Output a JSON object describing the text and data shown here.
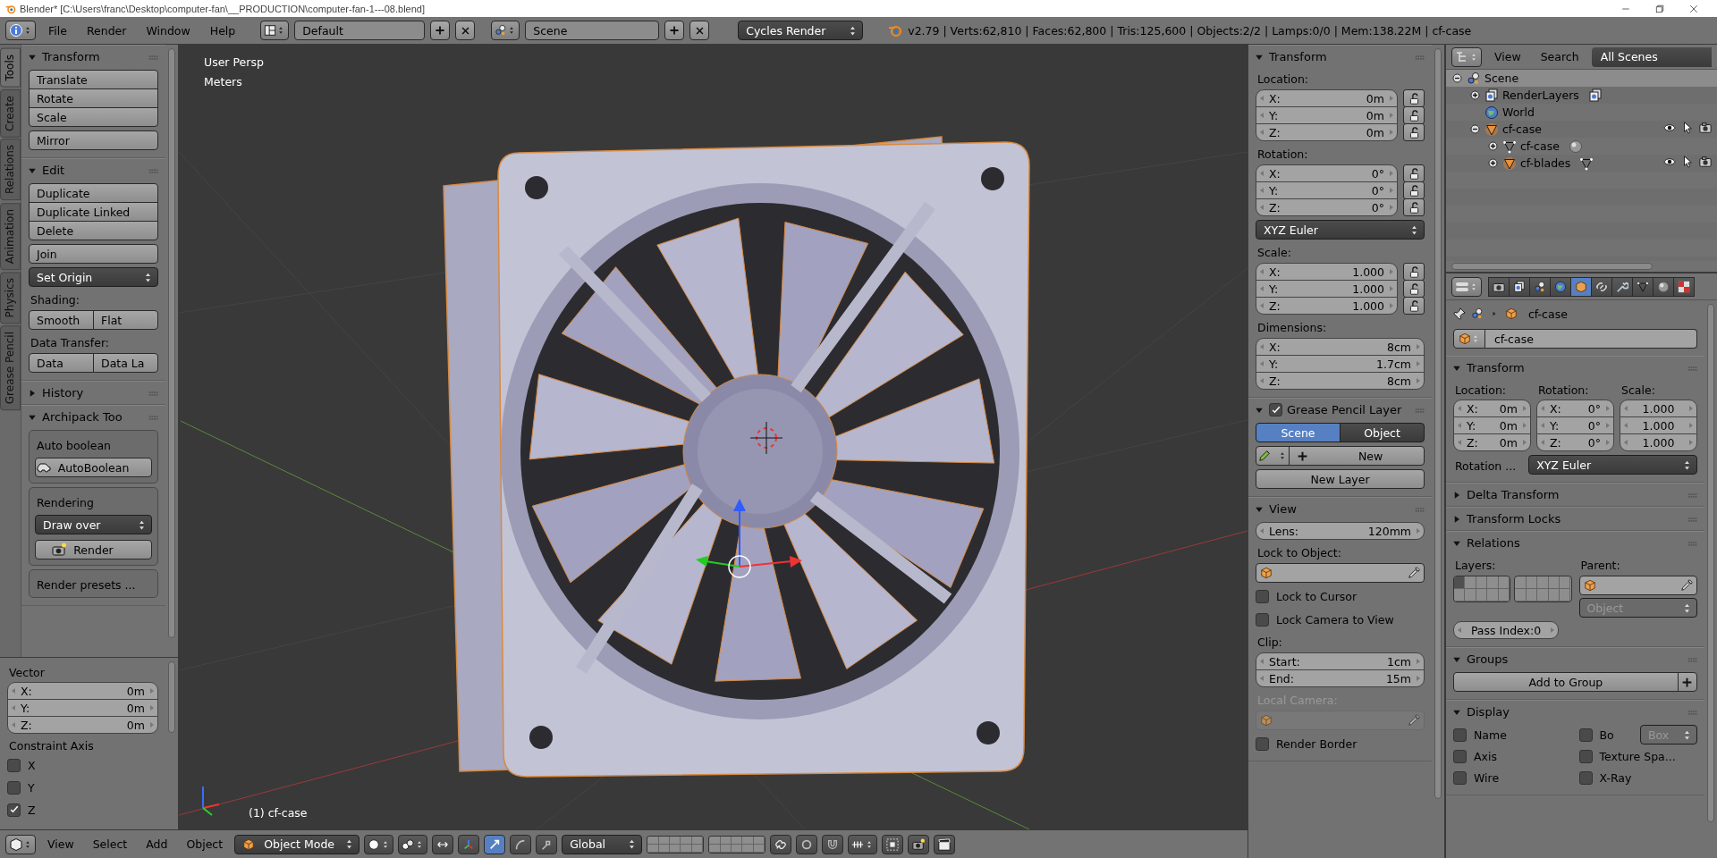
{
  "title_bar": {
    "title": "Blender* [C:\\Users\\franc\\Desktop\\computer-fan\\__PRODUCTION\\computer-fan-1---08.blend]"
  },
  "info_header": {
    "menus": [
      "File",
      "Render",
      "Window",
      "Help"
    ],
    "layout": "Default",
    "scene": "Scene",
    "engine": "Cycles Render",
    "stats": "v2.79 | Verts:62,810 | Faces:62,800 | Tris:125,600 | Objects:2/2 | Lamps:0/0 | Mem:138.22M | cf-case"
  },
  "tool_shelf": {
    "tabs": [
      {
        "label": "Tools",
        "selected": true
      },
      {
        "label": "Create",
        "selected": false
      },
      {
        "label": "Relations",
        "selected": false
      },
      {
        "label": "Animation",
        "selected": false
      },
      {
        "label": "Physics",
        "selected": false
      },
      {
        "label": "Grease Pencil",
        "selected": false
      }
    ],
    "panels": [
      {
        "title": "Transform",
        "expanded": true,
        "rows": [
          {
            "kind": "group",
            "items": [
              "Translate",
              "Rotate",
              "Scale"
            ]
          },
          {
            "kind": "button",
            "label": "Mirror"
          }
        ]
      },
      {
        "title": "Edit",
        "expanded": true,
        "rows": [
          {
            "kind": "group",
            "items": [
              "Duplicate",
              "Duplicate Linked",
              "Delete"
            ]
          },
          {
            "kind": "button",
            "label": "Join"
          },
          {
            "kind": "dropdown",
            "value": "Set Origin"
          },
          {
            "kind": "label",
            "text": "Shading:"
          },
          {
            "kind": "pair",
            "items": [
              "Smooth",
              "Flat"
            ]
          },
          {
            "kind": "label",
            "text": "Data Transfer:"
          },
          {
            "kind": "pair",
            "items": [
              "Data",
              "Data La"
            ]
          }
        ]
      },
      {
        "title": "History",
        "expanded": false
      },
      {
        "title": "Archipack Too",
        "expanded": true,
        "rows": [
          {
            "kind": "box",
            "rows": [
              {
                "kind": "label",
                "text": "Auto boolean"
              },
              {
                "kind": "car_button",
                "label": "AutoBoolean"
              }
            ]
          },
          {
            "kind": "box",
            "rows": [
              {
                "kind": "label",
                "text": "Rendering"
              },
              {
                "kind": "dropdown",
                "value": "Draw over"
              },
              {
                "kind": "camera_button",
                "label": "Render"
              }
            ]
          },
          {
            "kind": "box",
            "rows": [
              {
                "kind": "label",
                "text": "Render presets ..."
              }
            ]
          }
        ]
      }
    ]
  },
  "operator_panel": {
    "title": "Vector",
    "rows": [
      {
        "kind": "fields",
        "items": [
          {
            "label": "X:",
            "value": "0m"
          },
          {
            "label": "Y:",
            "value": "0m"
          },
          {
            "label": "Z:",
            "value": "0m"
          }
        ]
      },
      {
        "kind": "label",
        "text": "Constraint Axis"
      },
      {
        "kind": "checkbox",
        "label": "X",
        "checked": false
      },
      {
        "kind": "checkbox",
        "label": "Y",
        "checked": false
      },
      {
        "kind": "checkbox",
        "label": "Z",
        "checked": true
      }
    ]
  },
  "viewport": {
    "view_name": "User Persp",
    "units": "Meters",
    "object_label": "(1) cf-case"
  },
  "n_panel": {
    "panels": [
      {
        "title": "Transform",
        "expanded": true,
        "rows": [
          {
            "kind": "label",
            "text": "Location:"
          },
          {
            "kind": "fields",
            "items": [
              {
                "label": "X:",
                "value": "0m",
                "locked": false
              },
              {
                "label": "Y:",
                "value": "0m",
                "locked": false
              },
              {
                "label": "Z:",
                "value": "0m",
                "locked": false
              }
            ]
          },
          {
            "kind": "label",
            "text": "Rotation:"
          },
          {
            "kind": "fields",
            "items": [
              {
                "label": "X:",
                "value": "0°",
                "locked": false
              },
              {
                "label": "Y:",
                "value": "0°",
                "locked": false
              },
              {
                "label": "Z:",
                "value": "0°",
                "locked": false
              }
            ]
          },
          {
            "kind": "dropdown",
            "value": "XYZ Euler"
          },
          {
            "kind": "label",
            "text": "Scale:"
          },
          {
            "kind": "fields",
            "items": [
              {
                "label": "X:",
                "value": "1.000",
                "locked": false
              },
              {
                "label": "Y:",
                "value": "1.000",
                "locked": false
              },
              {
                "label": "Z:",
                "value": "1.000",
                "locked": false
              }
            ]
          },
          {
            "kind": "label",
            "text": "Dimensions:"
          },
          {
            "kind": "fields",
            "items": [
              {
                "label": "X:",
                "value": "8cm"
              },
              {
                "label": "Y:",
                "value": "1.7cm"
              },
              {
                "label": "Z:",
                "value": "8cm"
              }
            ]
          }
        ]
      },
      {
        "title": "Grease Pencil Layer",
        "expanded": true,
        "checked": true,
        "rows": [
          {
            "kind": "toggle",
            "items": [
              {
                "label": "Scene",
                "selected": true
              },
              {
                "label": "Object",
                "selected": false
              }
            ]
          },
          {
            "kind": "pencil_new",
            "label": "New"
          },
          {
            "kind": "button",
            "label": "New Layer"
          }
        ]
      },
      {
        "title": "View",
        "expanded": true,
        "rows": [
          {
            "kind": "fields",
            "items": [
              {
                "label": "Lens:",
                "value": "120mm"
              }
            ]
          },
          {
            "kind": "label",
            "text": "Lock to Object:"
          },
          {
            "kind": "object_field",
            "disabled": false
          },
          {
            "kind": "checkbox",
            "label": "Lock to Cursor",
            "checked": false
          },
          {
            "kind": "checkbox",
            "label": "Lock Camera to View",
            "checked": false
          },
          {
            "kind": "label",
            "text": "Clip:"
          },
          {
            "kind": "fields",
            "items": [
              {
                "label": "Start:",
                "value": "1cm"
              },
              {
                "label": "End:",
                "value": "15m"
              }
            ]
          },
          {
            "kind": "label",
            "text": "Local Camera:",
            "disabled": true
          },
          {
            "kind": "object_field",
            "disabled": true
          },
          {
            "kind": "checkbox",
            "label": "Render Border",
            "checked": false
          }
        ]
      }
    ]
  },
  "outliner": {
    "menus": [
      "View",
      "Search"
    ],
    "filter": "All Scenes",
    "tree": [
      {
        "name": "Scene",
        "kind": "scene",
        "expanded": true,
        "selected": true,
        "children": [
          {
            "name": "RenderLayers",
            "kind": "renderlayers",
            "expanded": false,
            "selected": false
          },
          {
            "name": "World",
            "kind": "world",
            "selected": false
          },
          {
            "name": "cf-case",
            "kind": "object",
            "expanded": true,
            "selected": false,
            "visible": true,
            "children": [
              {
                "name": "cf-case",
                "kind": "mesh",
                "expanded": false,
                "selected": false
              },
              {
                "name": "cf-blades",
                "kind": "object",
                "expanded": false,
                "selected": false,
                "visible": true
              }
            ]
          }
        ]
      }
    ]
  },
  "properties": {
    "tabs": [
      {
        "kind": "render",
        "selected": false
      },
      {
        "kind": "renderlayers",
        "selected": false
      },
      {
        "kind": "scene",
        "selected": false
      },
      {
        "kind": "world",
        "selected": false
      },
      {
        "kind": "object",
        "selected": true
      },
      {
        "kind": "constraints",
        "selected": false
      },
      {
        "kind": "modifiers",
        "selected": false
      },
      {
        "kind": "data",
        "selected": false
      },
      {
        "kind": "material",
        "selected": false
      },
      {
        "kind": "texture",
        "selected": false
      }
    ],
    "breadcrumb": "cf-case",
    "object_name": "cf-case",
    "panels": [
      {
        "title": "Transform",
        "expanded": true,
        "rows": [
          {
            "kind": "columns",
            "columns": [
              {
                "label": "Location:",
                "items": [
                  {
                    "label": "X:",
                    "value": "0m"
                  },
                  {
                    "label": "Y:",
                    "value": "0m"
                  },
                  {
                    "label": "Z:",
                    "value": "0m"
                  }
                ]
              },
              {
                "label": "Rotation:",
                "items": [
                  {
                    "label": "X:",
                    "value": "0°"
                  },
                  {
                    "label": "Y:",
                    "value": "0°"
                  },
                  {
                    "label": "Z:",
                    "value": "0°"
                  }
                ]
              },
              {
                "label": "Scale:",
                "items": [
                  {
                    "value": "1.000"
                  },
                  {
                    "value": "1.000"
                  },
                  {
                    "value": "1.000"
                  }
                ]
              }
            ]
          },
          {
            "kind": "labeled_dropdown",
            "label": "Rotation ...",
            "value": "XYZ Euler"
          }
        ]
      },
      {
        "title": "Delta Transform",
        "expanded": false
      },
      {
        "title": "Transform Locks",
        "expanded": false
      },
      {
        "title": "Relations",
        "expanded": true,
        "rows": [
          {
            "kind": "relations",
            "layers_label": "Layers:",
            "parent_label": "Parent:",
            "parent_type": "Object",
            "pass_index": "Pass Index:0"
          }
        ]
      },
      {
        "title": "Groups",
        "expanded": true,
        "rows": [
          {
            "kind": "add_group",
            "label": "Add to Group"
          }
        ]
      },
      {
        "title": "Display",
        "expanded": true,
        "rows": [
          {
            "kind": "check_grid",
            "items": [
              {
                "label": "Name",
                "checked": false
              },
              {
                "label": "Bo",
                "checked": false,
                "dropdown": "Box"
              },
              {
                "label": "Axis",
                "checked": false
              },
              {
                "label": "Texture Spa...",
                "checked": false
              },
              {
                "label": "Wire",
                "checked": false
              },
              {
                "label": "X-Ray",
                "checked": false
              }
            ]
          }
        ]
      }
    ]
  },
  "view3d_header": {
    "menus": [
      "View",
      "Select",
      "Add",
      "Object"
    ],
    "mode": "Object Mode",
    "manipulators": [
      {
        "kind": "translate",
        "selected": true
      },
      {
        "kind": "rotate",
        "selected": false
      },
      {
        "kind": "scale",
        "selected": false
      }
    ],
    "orientation": "Global"
  }
}
